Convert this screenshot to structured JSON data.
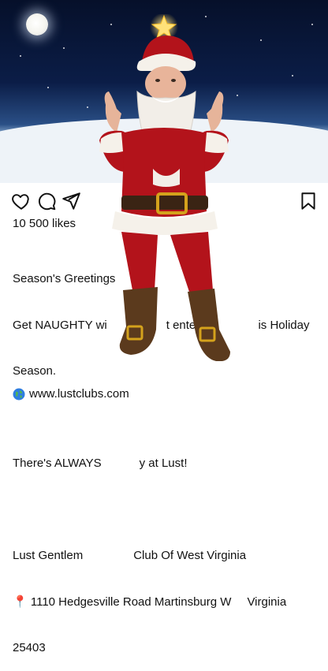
{
  "post": {
    "likes": "10 500 likes",
    "caption_lines": [
      "Season's Greetings",
      "Get NAUGHTY wi",
      "t entert",
      "is Holiday",
      "Season.",
      "",
      "There's ALWAYS",
      "y at Lust!",
      "",
      "Lust Gentlem",
      "Club Of West Virginia",
      "1110 Hedgesville Road Martinsburg W",
      "Virginia",
      "25403"
    ],
    "location_pin": "📍",
    "website": "www.lustclubs.com"
  },
  "icons": {
    "like": "heart-icon",
    "comment": "comment-icon",
    "share": "send-icon",
    "save": "bookmark-icon",
    "website": "globe-icon"
  },
  "colors": {
    "sky_top": "#06102a",
    "snow": "#eef3f8",
    "santa_red": "#b3131b",
    "fur": "#f5f1ea",
    "belt_gold": "#d4a21c"
  }
}
